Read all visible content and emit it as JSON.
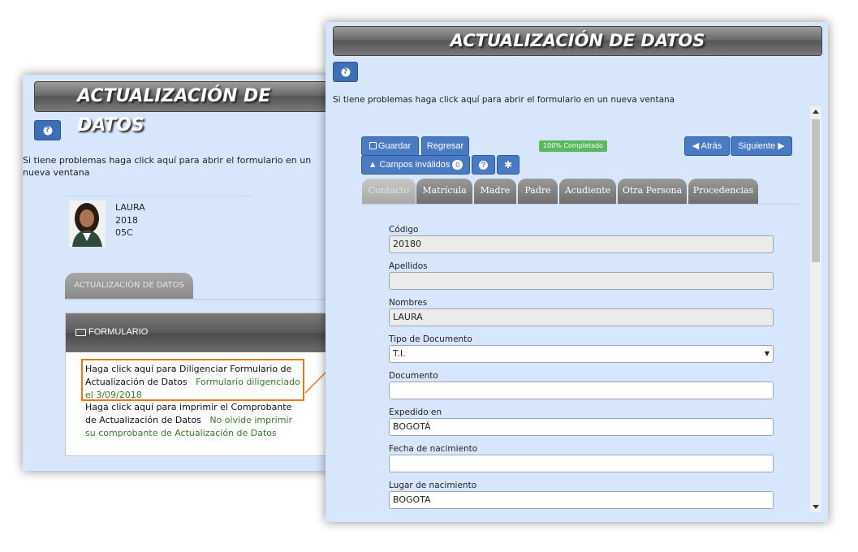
{
  "back_window": {
    "title": "ACTUALIZACIÓN DE DATOS",
    "help_text": "Si tiene problemas haga click aquí para abrir el formulario en un nueva ventana",
    "student": {
      "name": "LAURA",
      "year": "2018",
      "group": "05C"
    },
    "tab_label": "ACTUALIZACIÓN DE DATOS",
    "panel_title": "FORMULARIO",
    "link1": "Haga click aquí para Diligenciar Formulario de Actualización de Datos",
    "link1_status": "Formulario diligenciado el 3/09/2018",
    "link2": "Haga click aquí para imprimir el Comprobante de Actualización de Datos",
    "link2_status": "No olvide imprimir su comprobante de Actualización de Datos"
  },
  "front_window": {
    "title": "ACTUALIZACIÓN DE DATOS",
    "help_text": "Si tiene problemas haga click aquí para abrir el formulario en un nueva ventana",
    "toolbar": {
      "save": "Guardar",
      "back": "Regresar",
      "invalid": "Campos inválidos",
      "invalid_count": "0",
      "progress": "100% Completado",
      "progress_pct": 100,
      "prev": "Atrás",
      "next": "Siguiente"
    },
    "tabs": [
      "Contacto",
      "Matrícula",
      "Madre",
      "Padre",
      "Acudiente",
      "Otra Persona",
      "Procedencias"
    ],
    "fields": [
      {
        "label": "Código",
        "value": "20180"
      },
      {
        "label": "Apellidos",
        "value": ""
      },
      {
        "label": "Nombres",
        "value": "LAURA"
      },
      {
        "label": "Tipo de Documento",
        "value": "T.I."
      },
      {
        "label": "Documento",
        "value": ""
      },
      {
        "label": "Expedido en",
        "value": "BOGOTÁ"
      },
      {
        "label": "Fecha de nacimiento",
        "value": ""
      },
      {
        "label": "Lugar de nacimiento",
        "value": "BOGOTA"
      }
    ]
  },
  "colors": {
    "accent": "#4a7ac2",
    "bg": "#d8e6fb",
    "highlight": "#e07b15",
    "status_green": "#3a7a2a",
    "progress_green": "#5cb85c"
  }
}
